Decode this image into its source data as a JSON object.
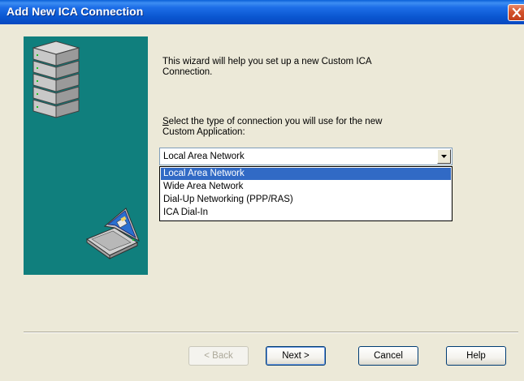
{
  "window": {
    "title": "Add New ICA Connection"
  },
  "wizard": {
    "intro_line1": "This wizard will help you set up a new Custom ICA",
    "intro_line2": "Connection.",
    "prompt_mnemonic": "S",
    "prompt_line1_rest": "elect the type of connection you will use for the new",
    "prompt_line2": "Custom Application:",
    "connection_type": {
      "selected": "Local Area Network",
      "options": [
        "Local Area Network",
        "Wide Area Network",
        "Dial-Up Networking (PPP/RAS)",
        "ICA Dial-In"
      ]
    }
  },
  "buttons": {
    "back": "< Back",
    "next": "Next >",
    "cancel": "Cancel",
    "help": "Help"
  },
  "colors": {
    "title_bar": "#0a56d0",
    "art_panel": "#107f7d",
    "selection": "#316ac5",
    "dialog_face": "#ece9d8"
  }
}
